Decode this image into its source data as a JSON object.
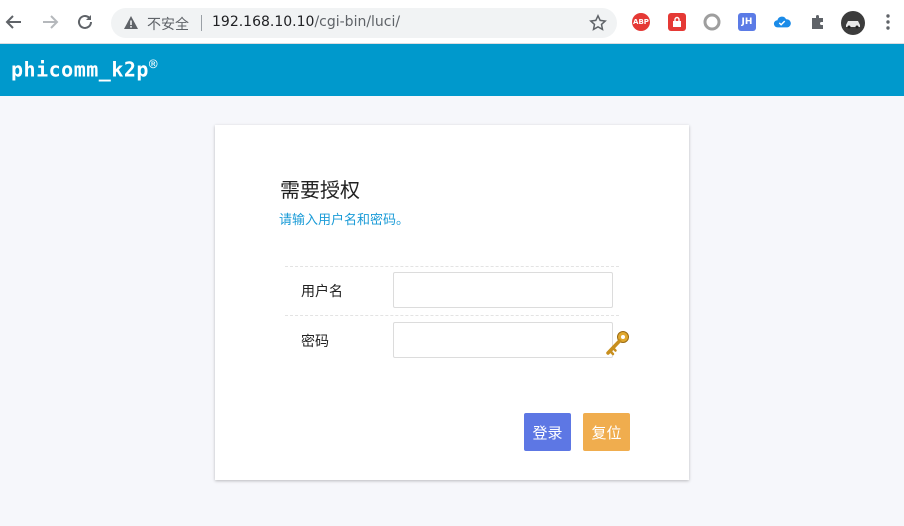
{
  "browser": {
    "security_label": "不安全",
    "url_host": "192.168.10.10",
    "url_path": "/cgi-bin/luci/",
    "extensions": [
      {
        "name": "abp-icon",
        "text": "ABP",
        "color": "#e53935"
      },
      {
        "name": "password-lock-icon",
        "text": "",
        "color": "#e53935"
      },
      {
        "name": "circle-extension-icon",
        "text": "",
        "color": "#9e9e9e"
      },
      {
        "name": "jh-extension-icon",
        "text": "JH",
        "color": "#5b7be6"
      },
      {
        "name": "cloud-check-icon",
        "text": "",
        "color": "#1a8be8"
      }
    ]
  },
  "header": {
    "brand": "phicomm_k2p",
    "brand_mark": "®"
  },
  "login": {
    "title": "需要授权",
    "subtitle": "请输入用户名和密码。",
    "username_label": "用户名",
    "username_value": "",
    "password_label": "密码",
    "password_value": "",
    "login_button": "登录",
    "reset_button": "复位"
  }
}
